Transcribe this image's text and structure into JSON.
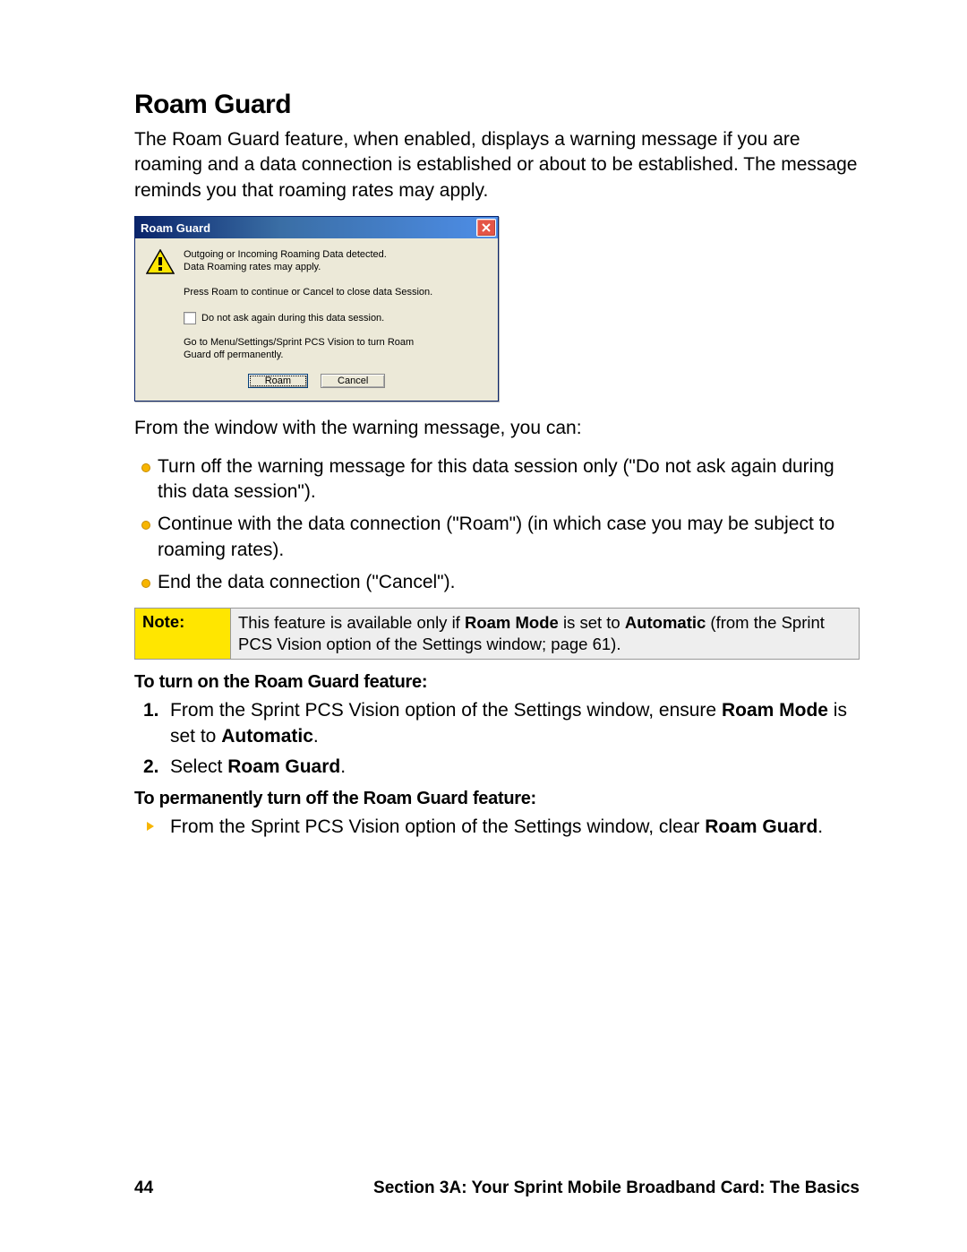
{
  "heading": "Roam Guard",
  "intro": "The Roam Guard feature, when enabled, displays a warning message if you are roaming and a data connection is established or about to be established. The message reminds you that roaming rates may apply.",
  "dialog": {
    "title": "Roam Guard",
    "line1": "Outgoing or Incoming Roaming Data detected.",
    "line2": "Data Roaming rates may apply.",
    "line3": "Press Roam to continue or Cancel to close data Session.",
    "checkbox_label": "Do not ask again during this data session.",
    "hint": "Go to Menu/Settings/Sprint PCS Vision to turn Roam Guard off permanently.",
    "btn_roam": "Roam",
    "btn_cancel": "Cancel"
  },
  "after_dialog": "From the window with the warning message, you can:",
  "options": [
    "Turn off the warning message for this data session only (\"Do not ask again during this data session\").",
    "Continue with the data connection (\"Roam\") (in which case you may be subject to roaming rates).",
    "End the data connection (\"Cancel\")."
  ],
  "note": {
    "label": "Note:",
    "pre": "This feature is available only if ",
    "bold1": "Roam Mode",
    "mid": " is set to ",
    "bold2": "Automatic",
    "post": " (from the Sprint PCS Vision option of the Settings window;  page 61)."
  },
  "turn_on_head": "To turn on the Roam Guard feature:",
  "steps_on": {
    "s1_pre": "From the Sprint PCS Vision option of the Settings window, ensure ",
    "s1_b1": "Roam Mode",
    "s1_mid": " is set to ",
    "s1_b2": "Automatic",
    "s1_post": ".",
    "s2_pre": "Select ",
    "s2_b": "Roam Guard",
    "s2_post": "."
  },
  "turn_off_head": "To permanently turn off the Roam Guard feature:",
  "turn_off": {
    "pre": "From the Sprint PCS Vision option of the Settings window, clear ",
    "b": "Roam Guard",
    "post": "."
  },
  "footer": {
    "page": "44",
    "section": "Section 3A: Your Sprint Mobile Broadband Card: The Basics"
  }
}
